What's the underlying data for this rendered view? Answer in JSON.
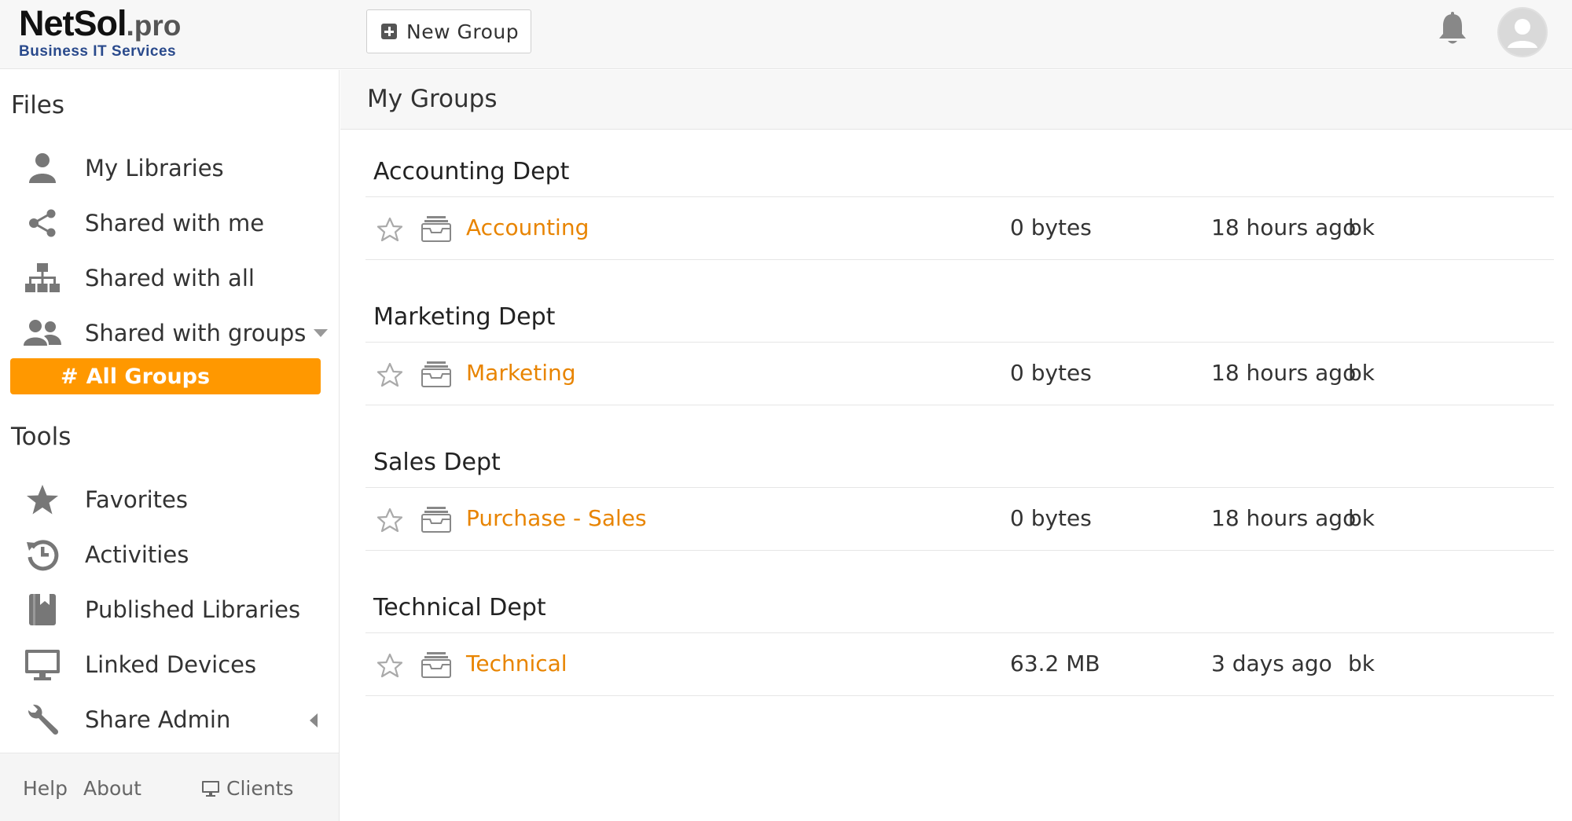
{
  "brand": {
    "name_main": "NetSol",
    "name_suffix": ".pro",
    "tagline": "Business IT Services"
  },
  "toolbar": {
    "new_group_label": "New Group"
  },
  "sidebar": {
    "files_heading": "Files",
    "files_items": [
      {
        "label": "My Libraries",
        "icon": "person-icon"
      },
      {
        "label": "Shared with me",
        "icon": "share-icon"
      },
      {
        "label": "Shared with all",
        "icon": "org-chart-icon"
      },
      {
        "label": "Shared with groups",
        "icon": "group-icon"
      }
    ],
    "all_groups_hash": "#",
    "all_groups_label": "All Groups",
    "tools_heading": "Tools",
    "tools_items": [
      {
        "label": "Favorites",
        "icon": "star-icon"
      },
      {
        "label": "Activities",
        "icon": "history-icon"
      },
      {
        "label": "Published Libraries",
        "icon": "book-icon"
      },
      {
        "label": "Linked Devices",
        "icon": "monitor-icon"
      },
      {
        "label": "Share Admin",
        "icon": "wrench-icon"
      }
    ],
    "footer": {
      "help": "Help",
      "about": "About",
      "clients": "Clients"
    }
  },
  "main": {
    "title": "My Groups",
    "groups": [
      {
        "name": "Accounting Dept",
        "repo": {
          "name": "Accounting",
          "size": "0 bytes",
          "modified": "18 hours ago",
          "owner": "bk"
        }
      },
      {
        "name": "Marketing Dept",
        "repo": {
          "name": "Marketing",
          "size": "0 bytes",
          "modified": "18 hours ago",
          "owner": "bk"
        }
      },
      {
        "name": "Sales Dept",
        "repo": {
          "name": "Purchase - Sales",
          "size": "0 bytes",
          "modified": "18 hours ago",
          "owner": "bk"
        }
      },
      {
        "name": "Technical Dept",
        "repo": {
          "name": "Technical",
          "size": "63.2 MB",
          "modified": "3 days ago",
          "owner": "bk"
        }
      }
    ]
  },
  "colors": {
    "accent": "#ff9800",
    "link": "#e88400",
    "brand_blue": "#2a4a8c"
  }
}
